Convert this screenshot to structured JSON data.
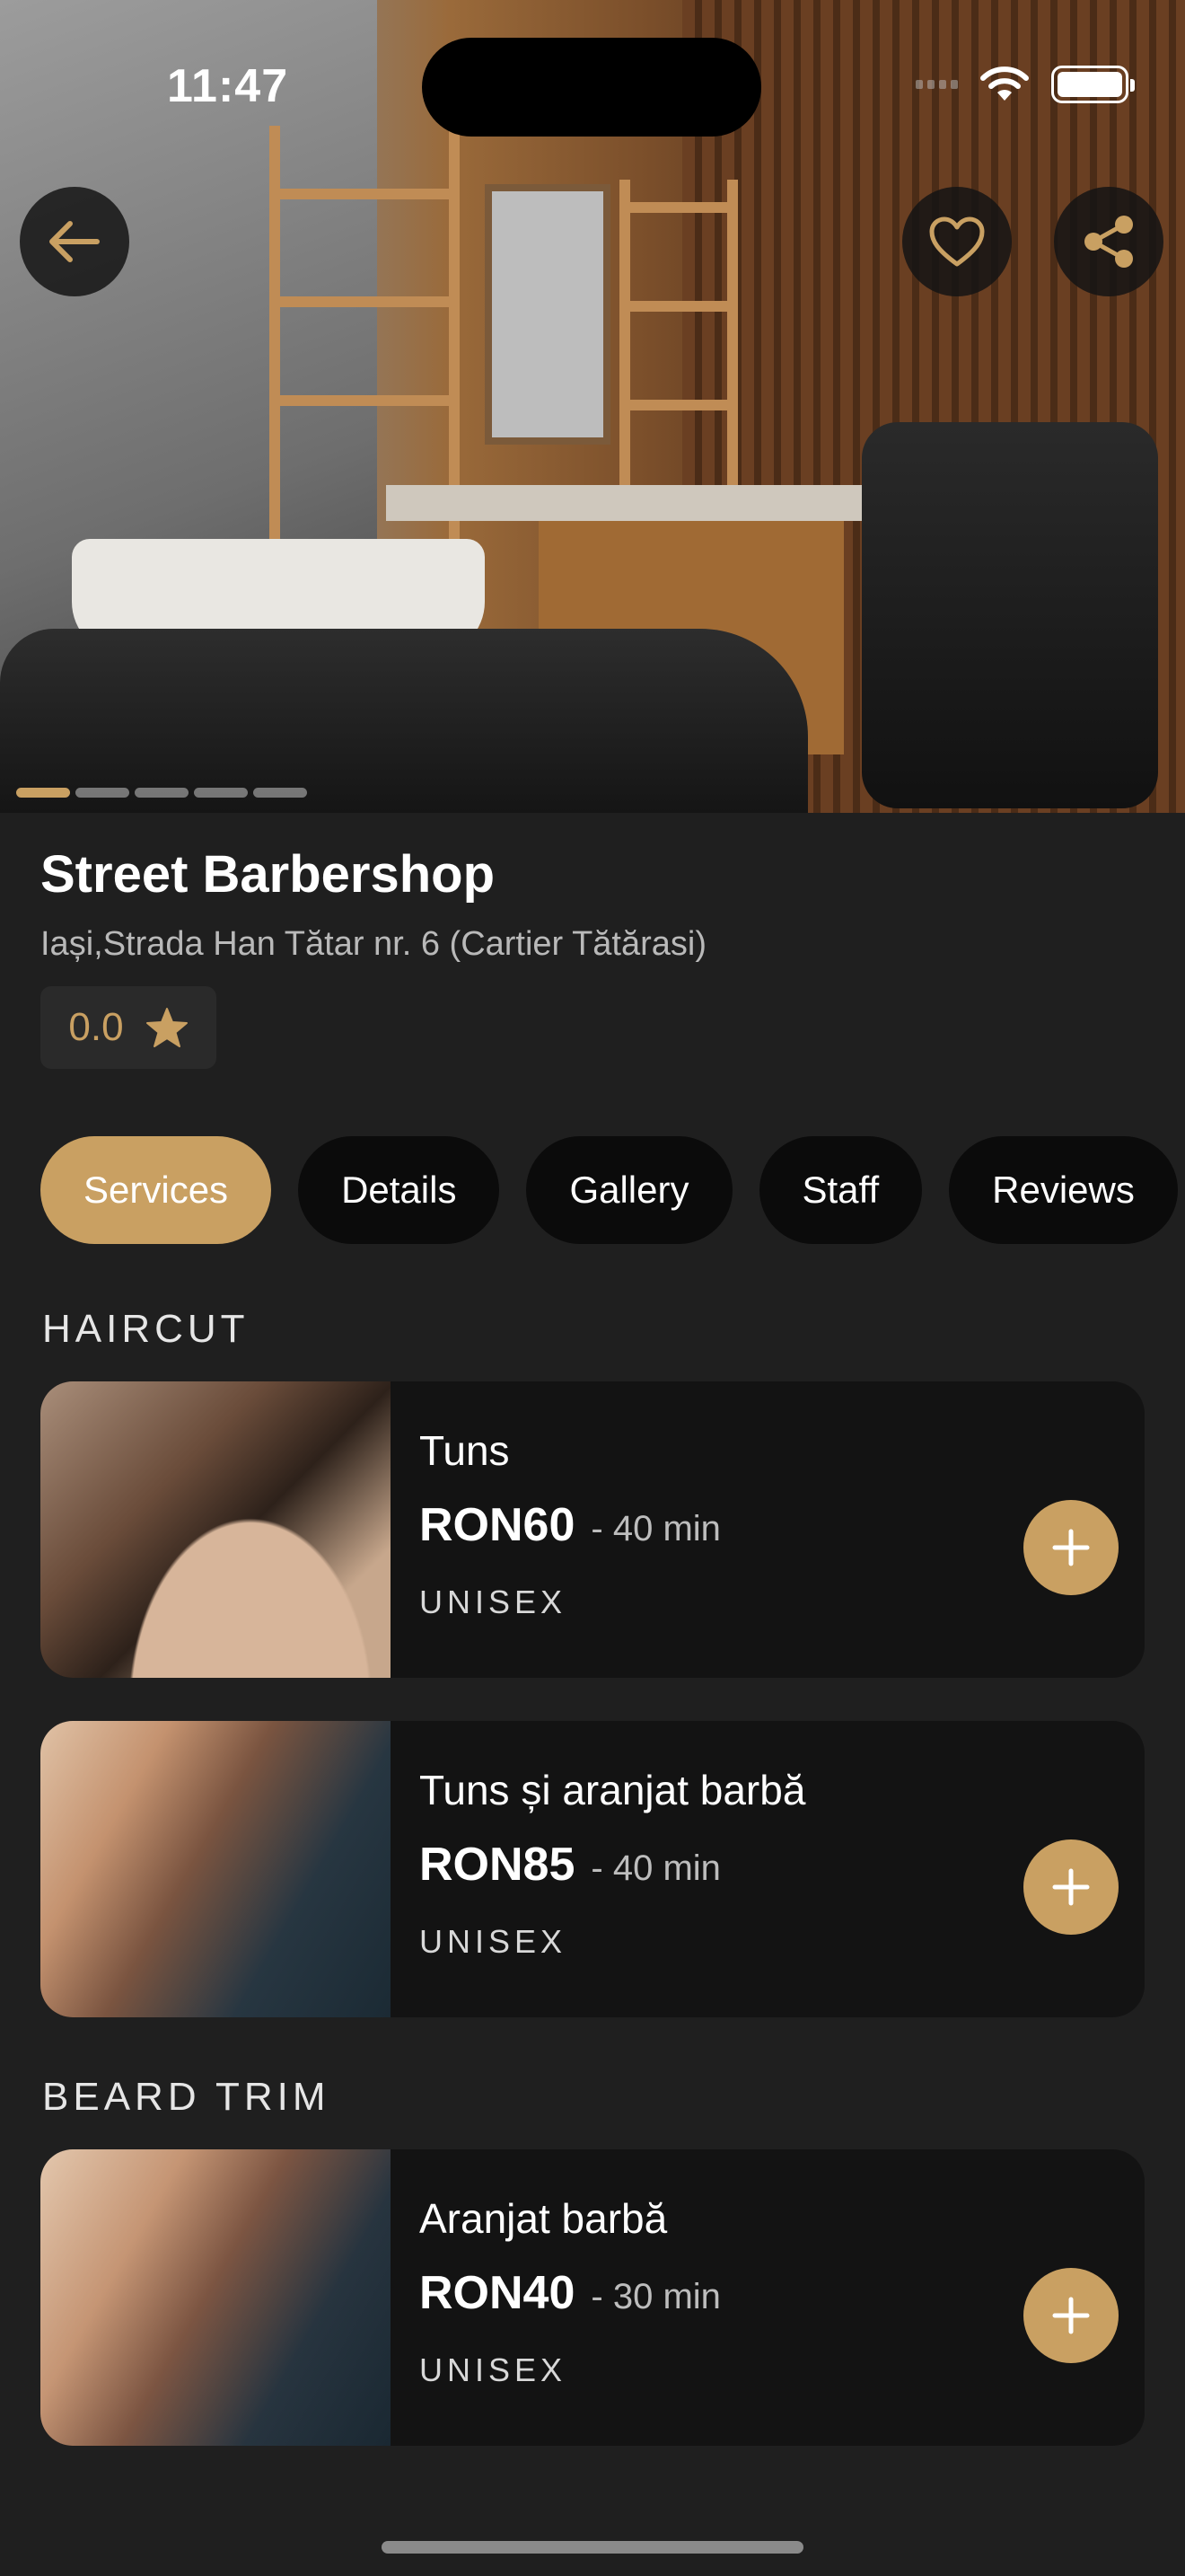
{
  "status_bar": {
    "time": "11:47"
  },
  "hero": {
    "carousel_total": 5,
    "carousel_active": 1
  },
  "shop": {
    "name": "Street Barbershop",
    "address": "Iași,Strada Han Tătar nr. 6 (Cartier Tătărasi)",
    "rating": "0.0"
  },
  "tabs": [
    {
      "label": "Services",
      "active": true
    },
    {
      "label": "Details",
      "active": false
    },
    {
      "label": "Gallery",
      "active": false
    },
    {
      "label": "Staff",
      "active": false
    },
    {
      "label": "Reviews",
      "active": false
    }
  ],
  "sections": [
    {
      "title": "HAIRCUT",
      "services": [
        {
          "name": "Tuns",
          "price": "RON60",
          "duration": "- 40 min",
          "gender": "UNISEX"
        },
        {
          "name": "Tuns și aranjat barbă",
          "price": "RON85",
          "duration": "- 40 min",
          "gender": "UNISEX"
        }
      ]
    },
    {
      "title": "BEARD TRIM",
      "services": [
        {
          "name": "Aranjat barbă",
          "price": "RON40",
          "duration": "- 30 min",
          "gender": "UNISEX"
        }
      ]
    }
  ],
  "colors": {
    "accent": "#c9a062",
    "background": "#1f1f1f",
    "card": "#131313",
    "tab_inactive": "#0b0b0b"
  }
}
